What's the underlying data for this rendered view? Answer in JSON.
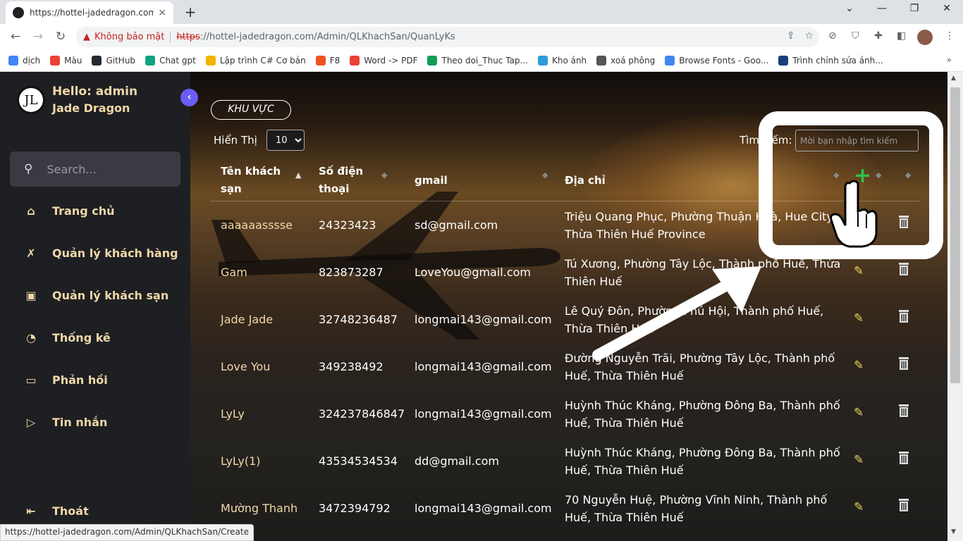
{
  "browser": {
    "tab_title": "https://hottel-jadedragon.com/A",
    "tab_close": "×",
    "new_tab": "+",
    "security_label": "Không bảo mật",
    "url_scheme": "https",
    "url_rest": "://hottel-jadedragon.com/Admin/QLKhachSan/QuanLyKs",
    "bookmarks": [
      {
        "label": "dịch",
        "color": "#4285f4"
      },
      {
        "label": "Màu",
        "color": "#ea4335"
      },
      {
        "label": "GitHub",
        "color": "#24292e"
      },
      {
        "label": "Chat gpt",
        "color": "#10a37f"
      },
      {
        "label": "Lập trình C# Cơ bản",
        "color": "#f4b400"
      },
      {
        "label": "F8",
        "color": "#f05123"
      },
      {
        "label": "Word -> PDF",
        "color": "#e94235"
      },
      {
        "label": "Theo doi_Thuc Tap...",
        "color": "#0f9d58"
      },
      {
        "label": "Kho ảnh",
        "color": "#2d9cdb"
      },
      {
        "label": "xoá phông",
        "color": "#555555"
      },
      {
        "label": "Browse Fonts - Goo...",
        "color": "#4285f4"
      },
      {
        "label": "Trình chỉnh sửa ảnh...",
        "color": "#1a3d7c"
      }
    ],
    "bookmarks_more": "»",
    "status_url": "https://hottel-jadedragon.com/Admin/QLKhachSan/Create"
  },
  "sidebar": {
    "greeting": "Hello: admin",
    "brand": "Jade Dragon",
    "search_placeholder": "Search...",
    "items": [
      {
        "label": "Trang chủ",
        "icon": "home-icon"
      },
      {
        "label": "Quản lý khách hàng",
        "icon": "user-x-icon"
      },
      {
        "label": "Quản lý khách sạn",
        "icon": "hotel-badge-icon"
      },
      {
        "label": "Thống kê",
        "icon": "clock-chart-icon"
      },
      {
        "label": "Phản hồi",
        "icon": "message-icon"
      },
      {
        "label": "Tin nhắn",
        "icon": "send-icon"
      }
    ],
    "logout": "Thoát"
  },
  "main": {
    "area_button": "KHU VỰC",
    "show_label": "Hiển Thị",
    "show_value": "10",
    "search_label": "Tìm kiếm:",
    "search_placeholder": "Mời bạn nhập tìm kiếm",
    "columns": [
      "Tên khách sạn",
      "Số điện thoại",
      "gmail",
      "Địa chỉ"
    ],
    "rows": [
      {
        "name": "aaaaaasssse",
        "phone": "24323423",
        "gmail": "sd@gmail.com",
        "address": "Triệu Quang Phục, Phường Thuận Hoà, Hue City, Thừa Thiên Huế Province"
      },
      {
        "name": "Gam",
        "phone": "823873287",
        "gmail": "LoveYou@gmail.com",
        "address": "Tú Xương, Phường Tây Lộc, Thành phố Huế, Thừa Thiên Huế"
      },
      {
        "name": "Jade Jade",
        "phone": "32748236487",
        "gmail": "longmai143@gmail.com",
        "address": "Lê Quý Đôn, Phường Phú Hội, Thành phố Huế, Thừa Thiên Huế"
      },
      {
        "name": "Love You",
        "phone": "349238492",
        "gmail": "longmai143@gmail.com",
        "address": "Đường Nguyễn Trãi, Phường Tây Lộc, Thành phố Huế, Thừa Thiên Huế"
      },
      {
        "name": "LyLy",
        "phone": "324237846847",
        "gmail": "longmai143@gmail.com",
        "address": "Huỳnh Thúc Kháng, Phường Đông Ba, Thành phố Huế, Thừa Thiên Huế"
      },
      {
        "name": "LyLy(1)",
        "phone": "43534534534",
        "gmail": "dd@gmail.com",
        "address": "Huỳnh Thúc Kháng, Phường Đông Ba, Thành phố Huế, Thừa Thiên Huế"
      },
      {
        "name": "Mường Thanh",
        "phone": "3472394792",
        "gmail": "longmai143@gmail.com",
        "address": "70 Nguyễn Huệ, Phường Vĩnh Ninh, Thành phố Huế, Thừa Thiên Huế"
      }
    ]
  },
  "colors": {
    "sidebar_bg": "#1e1f22",
    "accent_text": "#f0d7a8",
    "collapse_button": "#6b5cf6",
    "add_icon": "#35c04a",
    "edit_icon": "#e8d25a",
    "warning": "#c5221f"
  }
}
